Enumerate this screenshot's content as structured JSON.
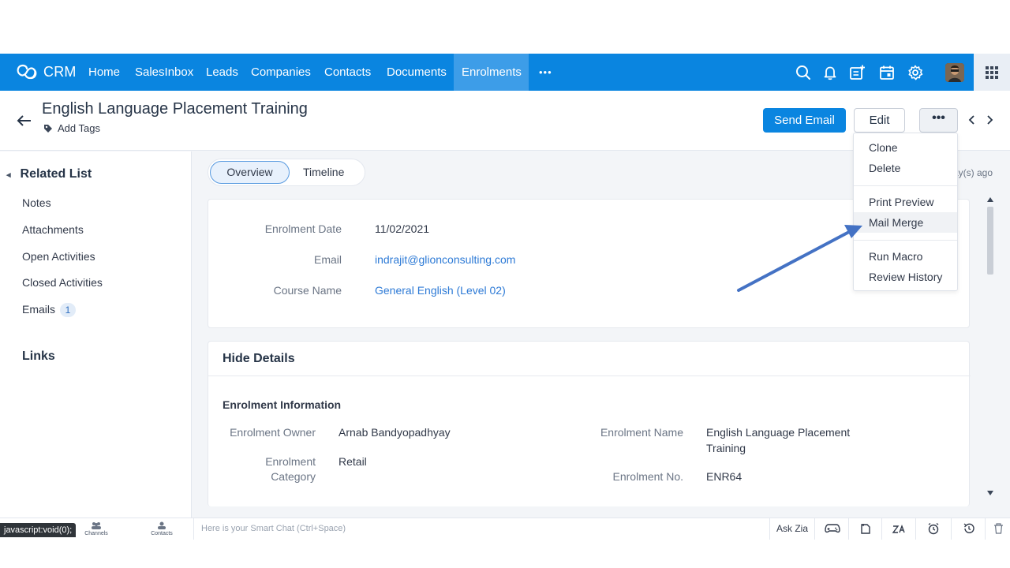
{
  "brand": {
    "name": "CRM"
  },
  "nav": {
    "items": [
      "Home",
      "SalesInbox",
      "Leads",
      "Companies",
      "Contacts",
      "Documents",
      "Enrolments"
    ],
    "more": "•••",
    "active": "Enrolments"
  },
  "record": {
    "title": "English Language Placement Training",
    "add_tags": "Add Tags",
    "send_email": "Send Email",
    "edit": "Edit",
    "more": "•••"
  },
  "dropdown": {
    "items": [
      "Clone",
      "Delete",
      "Print Preview",
      "Mail Merge",
      "Run Macro",
      "Review History"
    ],
    "highlighted": "Mail Merge"
  },
  "sidebar": {
    "related_list": "Related List",
    "items": [
      "Notes",
      "Attachments",
      "Open Activities",
      "Closed Activities",
      "Emails"
    ],
    "emails_count": "1",
    "links": "Links"
  },
  "tabs": {
    "overview": "Overview",
    "timeline": "Timeline"
  },
  "last_updated": "ay(s) ago",
  "summary": {
    "enrolment_date_label": "Enrolment Date",
    "enrolment_date": "11/02/2021",
    "email_label": "Email",
    "email": "indrajit@glionconsulting.com",
    "course_label": "Course Name",
    "course": "General English (Level 02)"
  },
  "details": {
    "hide_details": "Hide Details",
    "section": "Enrolment Information",
    "owner_label": "Enrolment Owner",
    "owner": "Arnab Bandyopadhyay",
    "category_label_1": "Enrolment",
    "category_label_2": "Category",
    "category": "Retail",
    "name_label": "Enrolment Name",
    "name_1": "English Language Placement",
    "name_2": "Training",
    "no_label": "Enrolment No.",
    "no": "ENR64"
  },
  "footer": {
    "status_url": "javascript:void(0);",
    "channels": "Channels",
    "contacts": "Contacts",
    "smart_chat": "Here is your Smart Chat (Ctrl+Space)",
    "ask_zia": "Ask Zia"
  },
  "colors": {
    "nav_blue": "#0a85e0",
    "link": "#2d7ad6",
    "arrow": "#4472c4"
  }
}
